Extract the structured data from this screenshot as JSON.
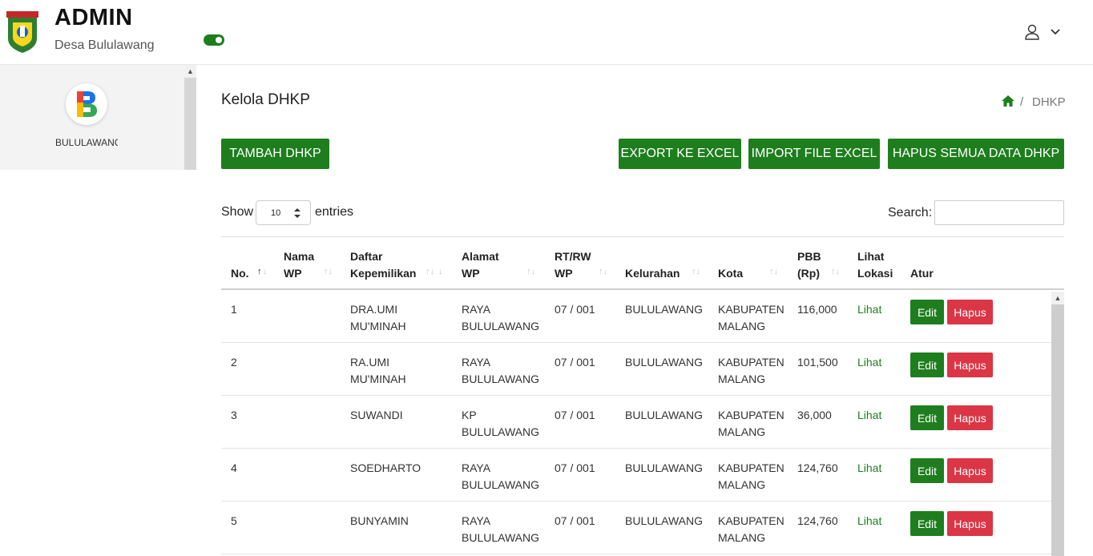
{
  "header": {
    "title": "ADMIN",
    "subtitle": "Desa Bululawang",
    "dark_mode_toggle": "on",
    "user_icon": "user-icon",
    "menu_icon": "chevron-down-icon"
  },
  "sidebar": {
    "avatar_letter": "B",
    "label": "BULULAWANG"
  },
  "breadcrumb": {
    "home_icon": "home-icon",
    "separator": "/",
    "current": "DHKP"
  },
  "page": {
    "title": "Kelola DHKP"
  },
  "buttons": {
    "tambah": "TAMBAH DHKP",
    "export": "EXPORT KE EXCEL",
    "import": "IMPORT FILE EXCEL",
    "hapus_semua": "HAPUS SEMUA DATA DHKP"
  },
  "table_controls": {
    "show": "Show",
    "entries_value": "10",
    "entries": "entries",
    "search": "Search:"
  },
  "table": {
    "headers": {
      "no": "No.",
      "nama_1": "Nama",
      "nama_2": "WP",
      "daftar_1": "Daftar",
      "daftar_2": "Kepemilikan",
      "alamat_1": "Alamat",
      "alamat_2": "WP",
      "rtrw_1": "RT/RW",
      "rtrw_2": "WP",
      "kelurahan": "Kelurahan",
      "kota": "Kota",
      "pbb_1": "PBB",
      "pbb_2": "(Rp)",
      "lihat_1": "Lihat",
      "lihat_2": "Lokasi",
      "atur": "Atur"
    },
    "rows": [
      {
        "no": "1",
        "nama": "",
        "daftar_1": "DRA.UMI",
        "daftar_2": "MU'MINAH",
        "alamat_1": "RAYA",
        "alamat_2": "BULULAWANG",
        "rtrw": "07 / 001",
        "kelurahan": "BULULAWANG",
        "kota_1": "KABUPATEN",
        "kota_2": "MALANG",
        "pbb": "116,000",
        "lihat": "Lihat",
        "edit": "Edit",
        "hapus": "Hapus"
      },
      {
        "no": "2",
        "nama": "",
        "daftar_1": "RA.UMI",
        "daftar_2": "MU'MINAH",
        "alamat_1": "RAYA",
        "alamat_2": "BULULAWANG",
        "rtrw": "07 / 001",
        "kelurahan": "BULULAWANG",
        "kota_1": "KABUPATEN",
        "kota_2": "MALANG",
        "pbb": "101,500",
        "lihat": "Lihat",
        "edit": "Edit",
        "hapus": "Hapus"
      },
      {
        "no": "3",
        "nama": "",
        "daftar_1": "SUWANDI",
        "daftar_2": "",
        "alamat_1": "KP",
        "alamat_2": "BULULAWANG",
        "rtrw": "07 / 001",
        "kelurahan": "BULULAWANG",
        "kota_1": "KABUPATEN",
        "kota_2": "MALANG",
        "pbb": "36,000",
        "lihat": "Lihat",
        "edit": "Edit",
        "hapus": "Hapus"
      },
      {
        "no": "4",
        "nama": "",
        "daftar_1": "SOEDHARTO",
        "daftar_2": "",
        "alamat_1": "RAYA",
        "alamat_2": "BULULAWANG",
        "rtrw": "07 / 001",
        "kelurahan": "BULULAWANG",
        "kota_1": "KABUPATEN",
        "kota_2": "MALANG",
        "pbb": "124,760",
        "lihat": "Lihat",
        "edit": "Edit",
        "hapus": "Hapus"
      },
      {
        "no": "5",
        "nama": "",
        "daftar_1": "BUNYAMIN",
        "daftar_2": "",
        "alamat_1": "RAYA",
        "alamat_2": "BULULAWANG",
        "rtrw": "07 / 001",
        "kelurahan": "BULULAWANG",
        "kota_1": "KABUPATEN",
        "kota_2": "MALANG",
        "pbb": "124,760",
        "lihat": "Lihat",
        "edit": "Edit",
        "hapus": "Hapus"
      }
    ]
  },
  "colors": {
    "primary_green": "#1e7e1e",
    "danger_red": "#dc3545"
  }
}
